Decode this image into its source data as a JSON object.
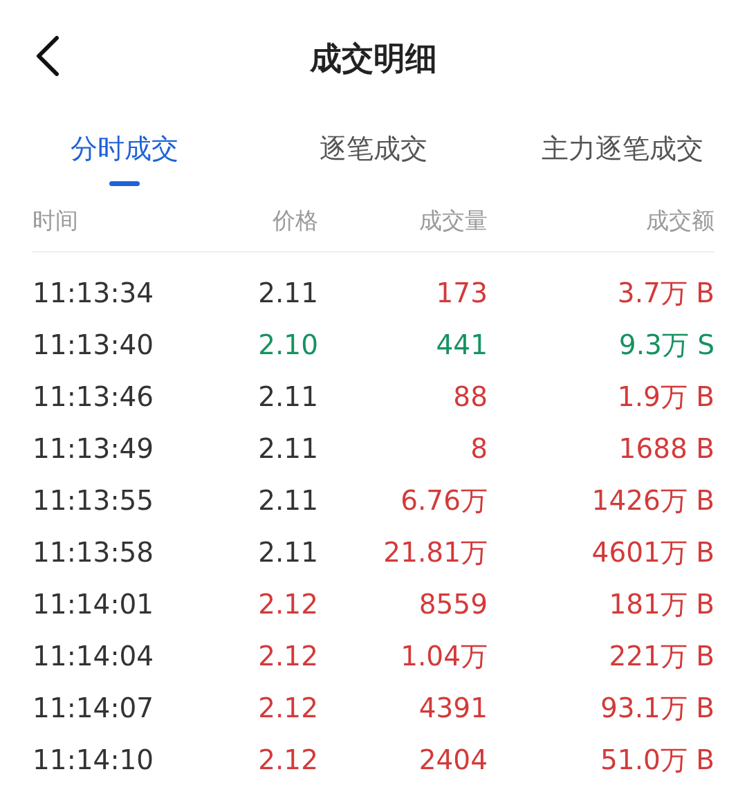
{
  "header": {
    "title": "成交明细"
  },
  "tabs": [
    {
      "label": "分时成交",
      "selected": true
    },
    {
      "label": "逐笔成交",
      "selected": false
    },
    {
      "label": "主力逐笔成交",
      "selected": false
    }
  ],
  "table": {
    "columns": [
      "时间",
      "价格",
      "成交量",
      "成交额"
    ],
    "rows": [
      {
        "time": "11:13:34",
        "price": {
          "text": "2.11",
          "color": "#333333"
        },
        "volume": {
          "text": "173",
          "color": "#d33a3a"
        },
        "amount": {
          "text": "3.7万 B",
          "color": "#d33a3a"
        }
      },
      {
        "time": "11:13:40",
        "price": {
          "text": "2.10",
          "color": "#169360"
        },
        "volume": {
          "text": "441",
          "color": "#169360"
        },
        "amount": {
          "text": "9.3万 S",
          "color": "#169360"
        }
      },
      {
        "time": "11:13:46",
        "price": {
          "text": "2.11",
          "color": "#333333"
        },
        "volume": {
          "text": "88",
          "color": "#d33a3a"
        },
        "amount": {
          "text": "1.9万 B",
          "color": "#d33a3a"
        }
      },
      {
        "time": "11:13:49",
        "price": {
          "text": "2.11",
          "color": "#333333"
        },
        "volume": {
          "text": "8",
          "color": "#d33a3a"
        },
        "amount": {
          "text": "1688 B",
          "color": "#d33a3a"
        }
      },
      {
        "time": "11:13:55",
        "price": {
          "text": "2.11",
          "color": "#333333"
        },
        "volume": {
          "text": "6.76万",
          "color": "#d33a3a"
        },
        "amount": {
          "text": "1426万 B",
          "color": "#d33a3a"
        }
      },
      {
        "time": "11:13:58",
        "price": {
          "text": "2.11",
          "color": "#333333"
        },
        "volume": {
          "text": "21.81万",
          "color": "#d33a3a"
        },
        "amount": {
          "text": "4601万 B",
          "color": "#d33a3a"
        }
      },
      {
        "time": "11:14:01",
        "price": {
          "text": "2.12",
          "color": "#d33a3a"
        },
        "volume": {
          "text": "8559",
          "color": "#d33a3a"
        },
        "amount": {
          "text": "181万 B",
          "color": "#d33a3a"
        }
      },
      {
        "time": "11:14:04",
        "price": {
          "text": "2.12",
          "color": "#d33a3a"
        },
        "volume": {
          "text": "1.04万",
          "color": "#d33a3a"
        },
        "amount": {
          "text": "221万 B",
          "color": "#d33a3a"
        }
      },
      {
        "time": "11:14:07",
        "price": {
          "text": "2.12",
          "color": "#d33a3a"
        },
        "volume": {
          "text": "4391",
          "color": "#d33a3a"
        },
        "amount": {
          "text": "93.1万 B",
          "color": "#d33a3a"
        }
      },
      {
        "time": "11:14:10",
        "price": {
          "text": "2.12",
          "color": "#d33a3a"
        },
        "volume": {
          "text": "2404",
          "color": "#d33a3a"
        },
        "amount": {
          "text": "51.0万 B",
          "color": "#d33a3a"
        }
      }
    ]
  }
}
